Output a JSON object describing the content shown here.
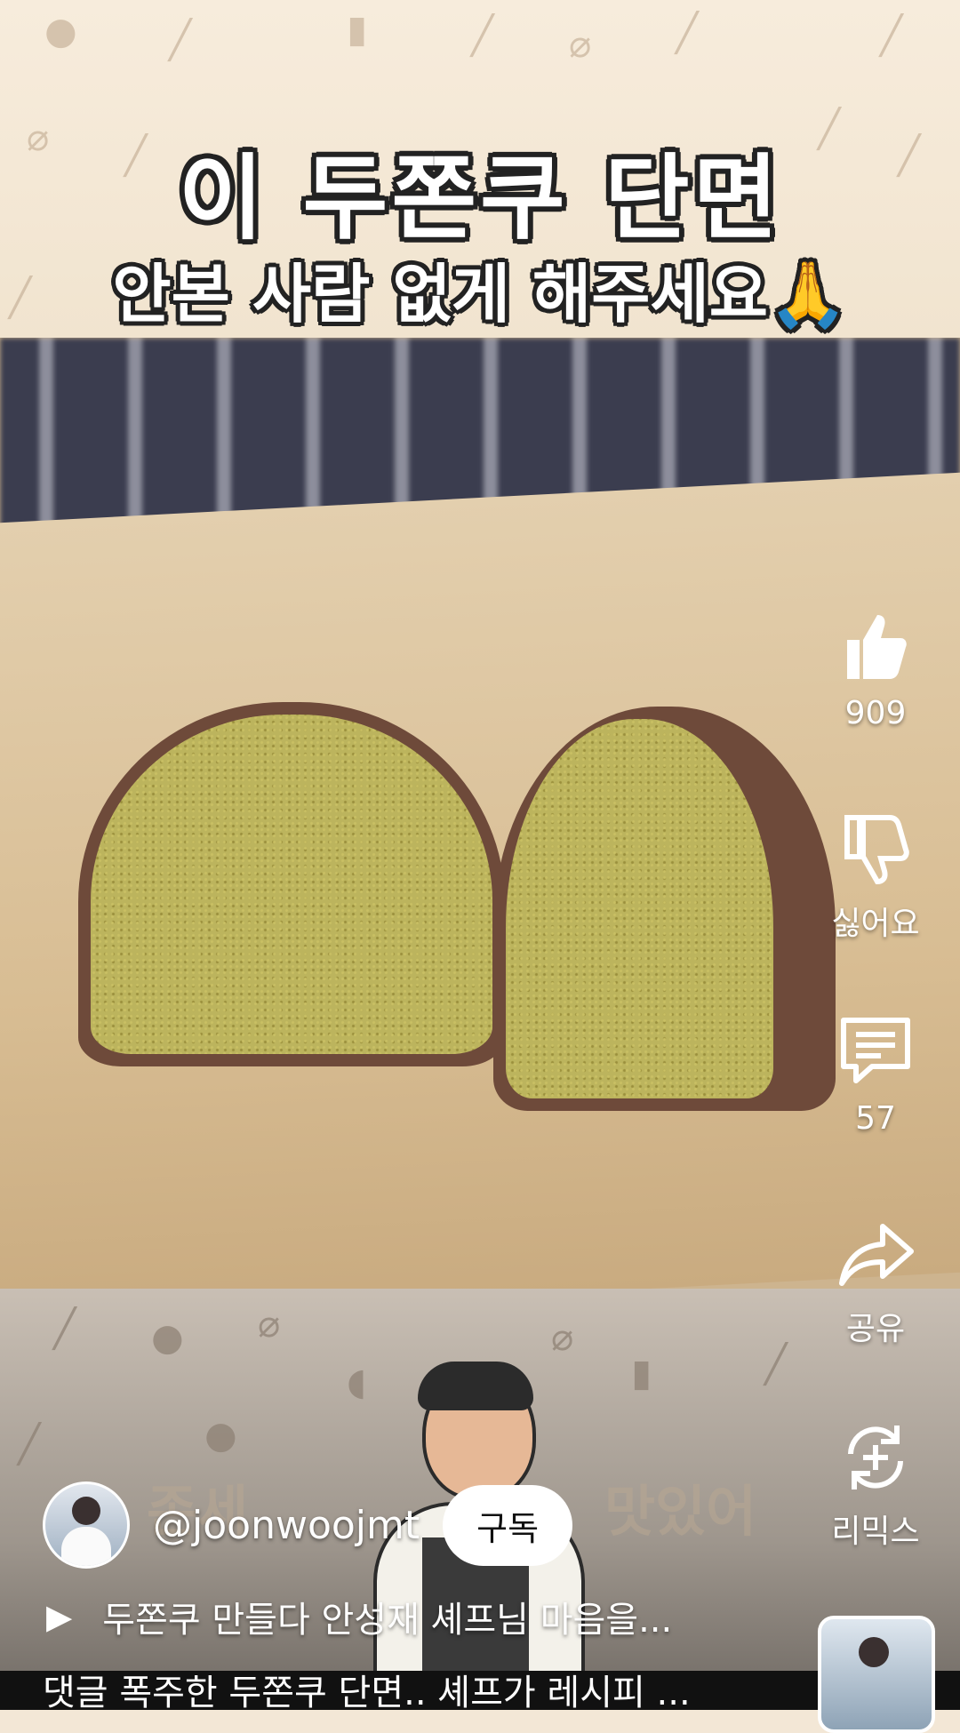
{
  "overlay": {
    "title_line1": "이 두쫀쿠 단면",
    "title_line2": "안본 사람 없게 해주세요🙏",
    "faded_left": "존세",
    "faded_right": "맛있어"
  },
  "actions": {
    "like": {
      "label": "909",
      "icon": "thumbs-up-icon"
    },
    "dislike": {
      "label": "싫어요",
      "icon": "thumbs-down-icon"
    },
    "comments": {
      "label": "57",
      "icon": "comment-icon"
    },
    "share": {
      "label": "공유",
      "icon": "share-icon"
    },
    "remix": {
      "label": "리믹스",
      "icon": "remix-icon"
    }
  },
  "channel": {
    "handle": "@joonwoojmt",
    "subscribe_label": "구독"
  },
  "playlist": {
    "play_symbol": "▶",
    "title": "두쫀쿠 만들다 안성재 셰프님 마음을..."
  },
  "caption": "댓글 폭주한 두쫀쿠 단면.. 셰프가 레시피 ..."
}
